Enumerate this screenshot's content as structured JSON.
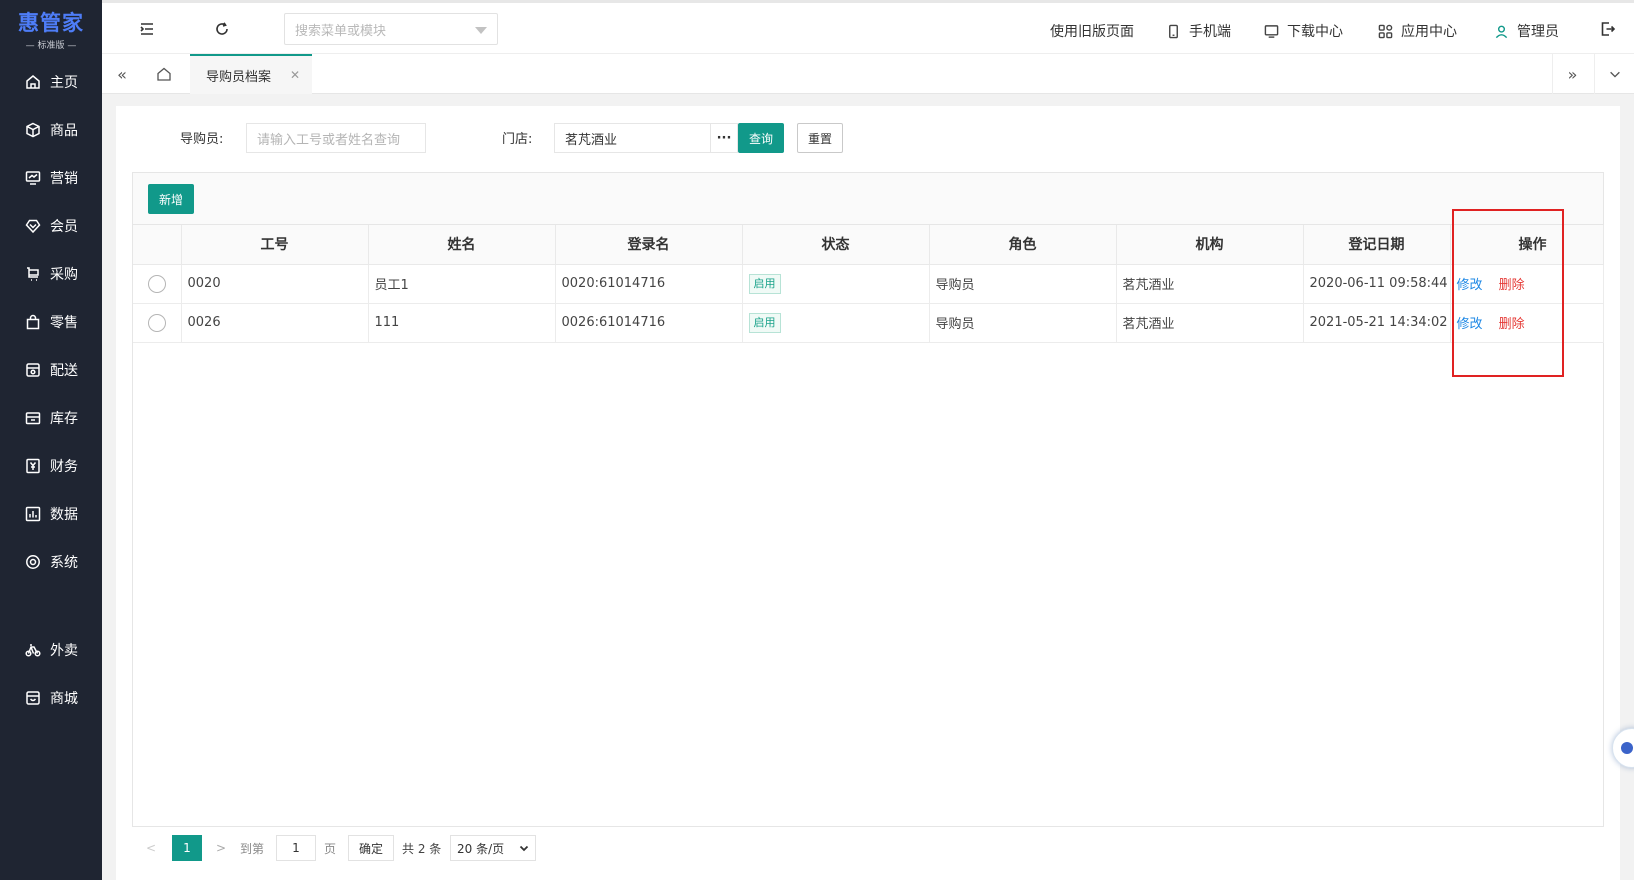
{
  "app": {
    "logo_text": "惠管家",
    "logo_sub": "— 标准版 —",
    "brand_color": "#4e7df7",
    "accent_color": "#11998a"
  },
  "sidebar": {
    "items": [
      {
        "label": "主页",
        "icon": "home-icon"
      },
      {
        "label": "商品",
        "icon": "cube-icon"
      },
      {
        "label": "营销",
        "icon": "chart-screen-icon"
      },
      {
        "label": "会员",
        "icon": "diamond-icon"
      },
      {
        "label": "采购",
        "icon": "cart-icon"
      },
      {
        "label": "零售",
        "icon": "bag-icon"
      },
      {
        "label": "配送",
        "icon": "delivery-icon"
      },
      {
        "label": "库存",
        "icon": "box-icon"
      },
      {
        "label": "财务",
        "icon": "yen-icon"
      },
      {
        "label": "数据",
        "icon": "bar-chart-icon"
      },
      {
        "label": "系统",
        "icon": "target-icon"
      },
      {
        "label": "外卖",
        "icon": "bike-icon"
      },
      {
        "label": "商城",
        "icon": "shop-icon"
      }
    ]
  },
  "header": {
    "search_placeholder": "搜索菜单或模块",
    "old_page": "使用旧版页面",
    "mobile": "手机端",
    "download": "下载中心",
    "apps": "应用中心",
    "user": "管理员"
  },
  "tabs": {
    "active": "导购员档案"
  },
  "filters": {
    "guide_label": "导购员:",
    "guide_placeholder": "请输入工号或者姓名查询",
    "store_label": "门店:",
    "store_value": "茗芃酒业",
    "dots": "···",
    "query": "查询",
    "reset": "重置"
  },
  "toolbar": {
    "add": "新增"
  },
  "table": {
    "columns": [
      "工号",
      "姓名",
      "登录名",
      "状态",
      "角色",
      "机构",
      "登记日期",
      "操作"
    ],
    "rows": [
      {
        "code": "0020",
        "name": "员工1",
        "login": "0020:61014716",
        "status": "启用",
        "role": "导购员",
        "org": "茗芃酒业",
        "date": "2020-06-11 09:58:44",
        "edit": "修改",
        "del": "删除"
      },
      {
        "code": "0026",
        "name": "111",
        "login": "0026:61014716",
        "status": "启用",
        "role": "导购员",
        "org": "茗芃酒业",
        "date": "2021-05-21 14:34:02",
        "edit": "修改",
        "del": "删除"
      }
    ]
  },
  "pager": {
    "current": "1",
    "goto_label": "到第",
    "goto_value": "1",
    "page_unit": "页",
    "confirm": "确定",
    "total": "共 2 条",
    "page_size": "20 条/页"
  }
}
